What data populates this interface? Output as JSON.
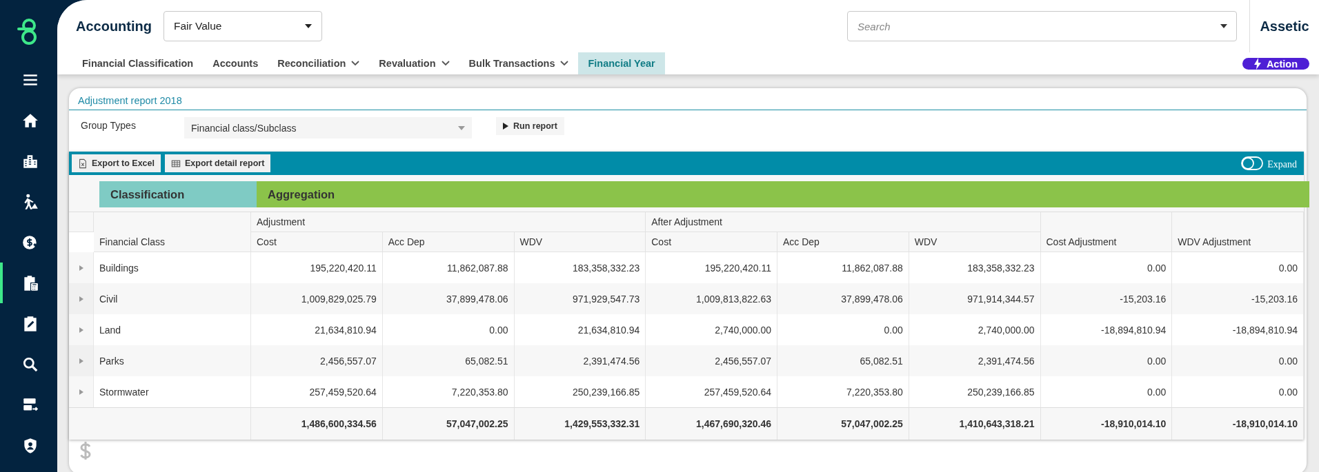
{
  "sidebar": {
    "items": [
      {
        "kind": "menu",
        "selected": false
      },
      {
        "kind": "home",
        "selected": false
      },
      {
        "kind": "buildings",
        "selected": false
      },
      {
        "kind": "worker",
        "selected": false
      },
      {
        "kind": "money",
        "selected": false
      },
      {
        "kind": "calculator",
        "selected": true
      },
      {
        "kind": "edit",
        "selected": false
      },
      {
        "kind": "search",
        "selected": false
      },
      {
        "kind": "server",
        "selected": false
      },
      {
        "kind": "shield",
        "selected": false
      }
    ]
  },
  "header": {
    "title": "Accounting",
    "module_select": {
      "value": "Fair Value"
    },
    "search": {
      "placeholder": "Search"
    },
    "organisation": "Assetic"
  },
  "nav": {
    "tabs": [
      {
        "label": "Financial Classification",
        "has_menu": false,
        "selected": false
      },
      {
        "label": "Accounts",
        "has_menu": false,
        "selected": false
      },
      {
        "label": "Reconciliation",
        "has_menu": true,
        "selected": false
      },
      {
        "label": "Revaluation",
        "has_menu": true,
        "selected": false
      },
      {
        "label": "Bulk Transactions",
        "has_menu": true,
        "selected": false
      },
      {
        "label": "Financial Year",
        "has_menu": false,
        "selected": true
      }
    ],
    "action_button": "Action"
  },
  "report": {
    "title": "Adjustment report 2018",
    "group_types": {
      "label": "Group Types",
      "value": "Financial class/Subclass"
    },
    "run_button": "Run report",
    "toolbar": {
      "buttons": [
        {
          "label": "Export to Excel",
          "kind": "excel"
        },
        {
          "label": "Export detail report",
          "kind": "grid"
        }
      ],
      "expand": {
        "label": "Expand",
        "on": false
      }
    },
    "table": {
      "zones": [
        {
          "label": "Classification",
          "kind": "rows"
        },
        {
          "label": "Aggregation",
          "kind": "data"
        }
      ],
      "row_header": "Financial Class",
      "groups": [
        {
          "label": "Adjustment",
          "columns": [
            "Cost",
            "Acc Dep",
            "WDV"
          ]
        },
        {
          "label": "After Adjustment",
          "columns": [
            "Cost",
            "Acc Dep",
            "WDV"
          ]
        }
      ],
      "single_columns": [
        "Cost Adjustment",
        "WDV Adjustment"
      ],
      "rows": [
        {
          "label": "Buildings",
          "expanded": false,
          "cells": [
            "195,220,420.11",
            "11,862,087.88",
            "183,358,332.23",
            "195,220,420.11",
            "11,862,087.88",
            "183,358,332.23",
            "0.00",
            "0.00"
          ]
        },
        {
          "label": "Civil",
          "expanded": false,
          "cells": [
            "1,009,829,025.79",
            "37,899,478.06",
            "971,929,547.73",
            "1,009,813,822.63",
            "37,899,478.06",
            "971,914,344.57",
            "-15,203.16",
            "-15,203.16"
          ]
        },
        {
          "label": "Land",
          "expanded": false,
          "cells": [
            "21,634,810.94",
            "0.00",
            "21,634,810.94",
            "2,740,000.00",
            "0.00",
            "2,740,000.00",
            "-18,894,810.94",
            "-18,894,810.94"
          ]
        },
        {
          "label": "Parks",
          "expanded": false,
          "cells": [
            "2,456,557.07",
            "65,082.51",
            "2,391,474.56",
            "2,456,557.07",
            "65,082.51",
            "2,391,474.56",
            "0.00",
            "0.00"
          ]
        },
        {
          "label": "Stormwater",
          "expanded": false,
          "cells": [
            "257,459,520.64",
            "7,220,353.80",
            "250,239,166.85",
            "257,459,520.64",
            "7,220,353.80",
            "250,239,166.85",
            "0.00",
            "0.00"
          ]
        }
      ],
      "totals": [
        "1,486,600,334.56",
        "57,047,002.25",
        "1,429,553,332.31",
        "1,467,690,320.46",
        "57,047,002.25",
        "1,410,643,318.21",
        "-18,910,014.10",
        "-18,910,014.10"
      ]
    }
  }
}
